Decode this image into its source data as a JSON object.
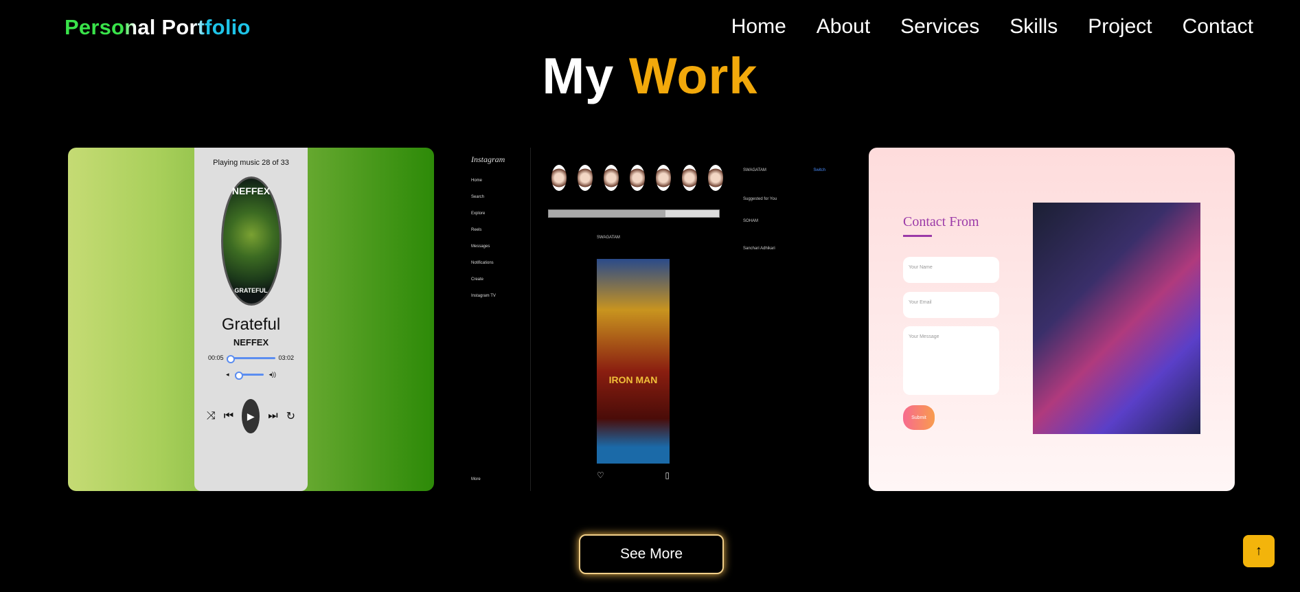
{
  "nav": {
    "logo": "Personal Portfolio",
    "items": [
      "Home",
      "About",
      "Services",
      "Skills",
      "Project",
      "Contact"
    ]
  },
  "heading": {
    "part1": "My",
    "part2": "Work"
  },
  "projects": {
    "music": {
      "header": "Playing music 28 of 33",
      "disc_brand": "NEFFEX",
      "disc_title": "GRATEFUL",
      "title": "Grateful",
      "artist": "NEFFEX",
      "time_current": "00:05",
      "time_total": "03:02"
    },
    "instagram": {
      "logo": "Instagram",
      "menu": [
        "Home",
        "Search",
        "Explore",
        "Reels",
        "Messages",
        "Notifications",
        "Create",
        "Instagram TV"
      ],
      "more": "More",
      "post_user": "SWAGATAM",
      "poster_text": "IRON MAN",
      "suggested_heading": "Suggested for You",
      "switch": "Switch",
      "me": "SWAGATAM",
      "sugg1": "SOHAM",
      "sugg2": "Sanchari Adhikari"
    },
    "contact": {
      "title": "Contact From",
      "name_placeholder": "Your Name",
      "email_placeholder": "Your Email",
      "message_placeholder": "Your Message",
      "submit": "Submit"
    }
  },
  "see_more": "See More",
  "colors": {
    "accent": "#f2a90b",
    "logo_green": "#39e34a",
    "logo_cyan": "#1ec4e8"
  }
}
